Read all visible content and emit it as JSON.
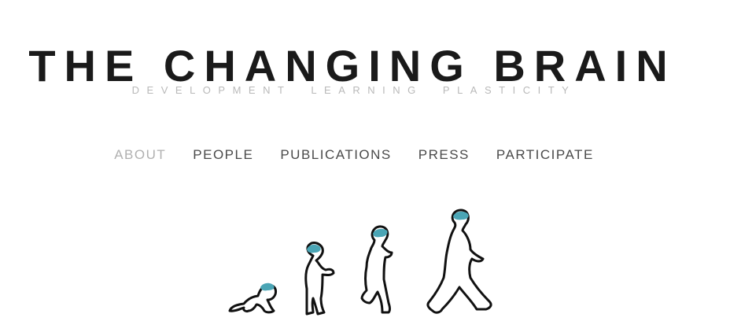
{
  "site": {
    "title": "THE CHANGING BRAIN",
    "tagline": [
      "DEVELOPMENT",
      "LEARNING",
      "PLASTICITY"
    ]
  },
  "nav": {
    "items": [
      {
        "label": "ABOUT",
        "active": true
      },
      {
        "label": "PEOPLE",
        "active": false
      },
      {
        "label": "PUBLICATIONS",
        "active": false
      },
      {
        "label": "PRESS",
        "active": false
      },
      {
        "label": "PARTICIPATE",
        "active": false
      }
    ]
  },
  "colors": {
    "title": "#1a1a1a",
    "tagline": "#b9b9b9",
    "nav": "#4a4a4a",
    "nav_active": "#b0b0b0",
    "brain": "#4aa5b5"
  },
  "hero": {
    "icon": "growth-stages-illustration"
  }
}
